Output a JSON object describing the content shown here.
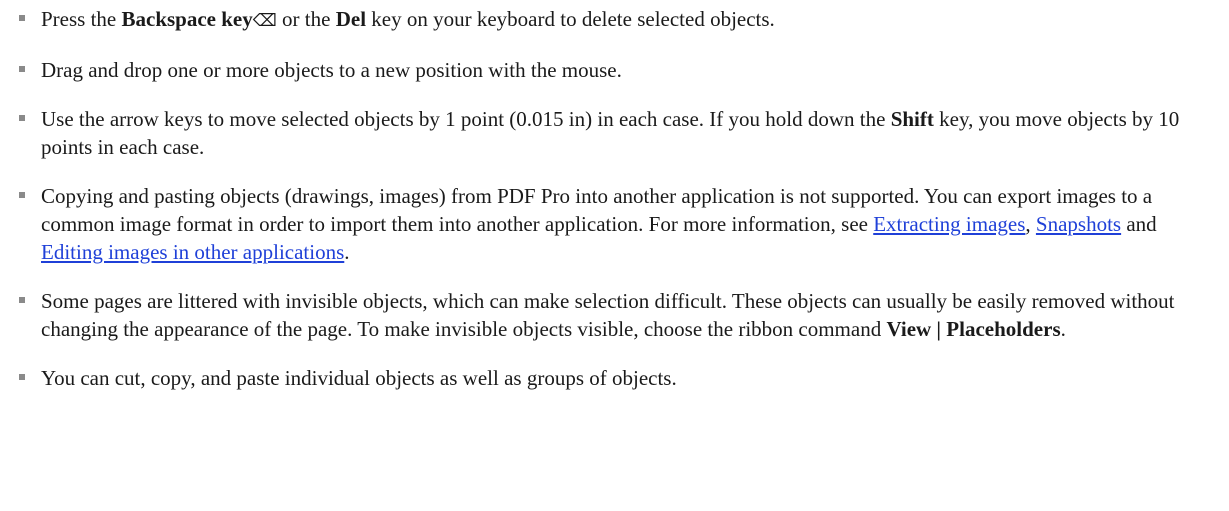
{
  "items": [
    {
      "p1": "Press the ",
      "b1": "Backspace key",
      "glyph": "⌫",
      "p2": " or the ",
      "b2": "Del",
      "p3": " key on your keyboard to delete selected objects."
    },
    {
      "p1": "Drag and drop one or more objects to a new position with the mouse."
    },
    {
      "p1": "Use the arrow keys to move selected objects by 1 point (0.015 in) in each case. If you hold down the ",
      "b1": "Shift",
      "p2": " key, you move objects by 10 points in each case."
    },
    {
      "p1": "Copying and pasting objects (drawings, images) from PDF Pro into another application is not supported. You can export images to a common image format in order to import them into another application. For more information, see ",
      "link1": "Extracting images",
      "p2": ", ",
      "link2": "Snapshots",
      "p3": " and ",
      "link3": "Editing images in other applications",
      "p4": "."
    },
    {
      "p1": "Some pages are littered with invisible objects, which can make selection difficult. These objects can usually be easily removed without changing the appearance of the page. To make invisible objects visible, choose the ribbon command ",
      "b1": "View | Placeholders",
      "p2": "."
    },
    {
      "p1": "You can cut, copy, and paste individual objects as well as groups of objects."
    }
  ],
  "colors": {
    "link": "#1f40d8",
    "bullet": "#8a8a8a",
    "text": "#1a1a1a"
  }
}
